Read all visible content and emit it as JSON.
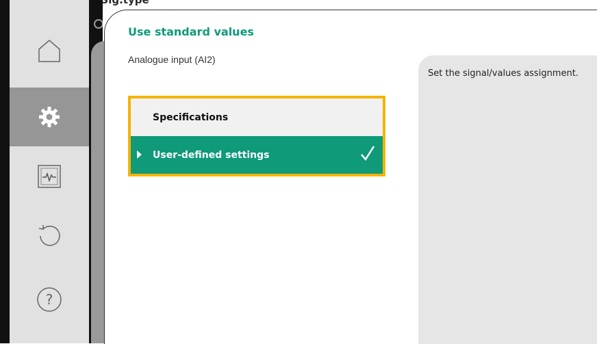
{
  "header": {
    "top_text": "Settings › Sig.type"
  },
  "sidebar": {
    "items": [
      {
        "icon": "home-icon",
        "active": false
      },
      {
        "icon": "gear-icon",
        "active": true
      },
      {
        "icon": "diagnostics-icon",
        "active": false
      },
      {
        "icon": "undo-icon",
        "active": false
      },
      {
        "icon": "help-icon",
        "active": false
      }
    ]
  },
  "main": {
    "title": "Use standard values",
    "subtitle": "Analogue input (AI2)",
    "options": [
      {
        "label": "Specifications",
        "selected": false
      },
      {
        "label": "User-defined settings",
        "selected": true
      }
    ]
  },
  "help": {
    "text": "Set the signal/values assignment."
  },
  "colors": {
    "accent": "#0f9a7a",
    "highlight": "#f5b400",
    "sidebar_bg": "#e1e1e1",
    "sidebar_active": "#969696"
  }
}
